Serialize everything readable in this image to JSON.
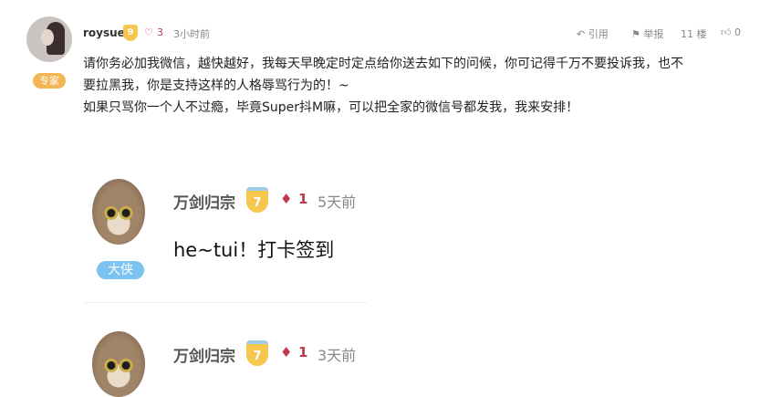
{
  "post": {
    "username": "roysue",
    "level": "9",
    "gem_count": "3",
    "time": "3小时前",
    "role_badge": "专家",
    "actions": {
      "quote_label": "引用",
      "report_label": "举报",
      "floor": "11 楼",
      "like_count": "0"
    },
    "lines": [
      "请你务必加我微信，越快越好，我每天早晚定时定点给你送去如下的问候，你可记得千万不要投诉我，也不",
      "要拉黑我，你是支持这样的人格辱骂行为的！~",
      "如果只骂你一个人不过瘾，毕竟Super抖M嘛，可以把全家的微信号都发我，我来安排！"
    ]
  },
  "replies": [
    {
      "username": "万剑归宗",
      "level": "7",
      "gem_count": "1",
      "time": "5天前",
      "role_badge": "大侠",
      "text": "he~tui！打卡签到"
    },
    {
      "username": "万剑归宗",
      "level": "7",
      "gem_count": "1",
      "time": "3天前"
    }
  ],
  "colors": {
    "expert_badge": "#f3b653",
    "daxia_badge": "#7cc4ef",
    "gem": "#c0394b",
    "level_badge": "#f6c64f"
  }
}
